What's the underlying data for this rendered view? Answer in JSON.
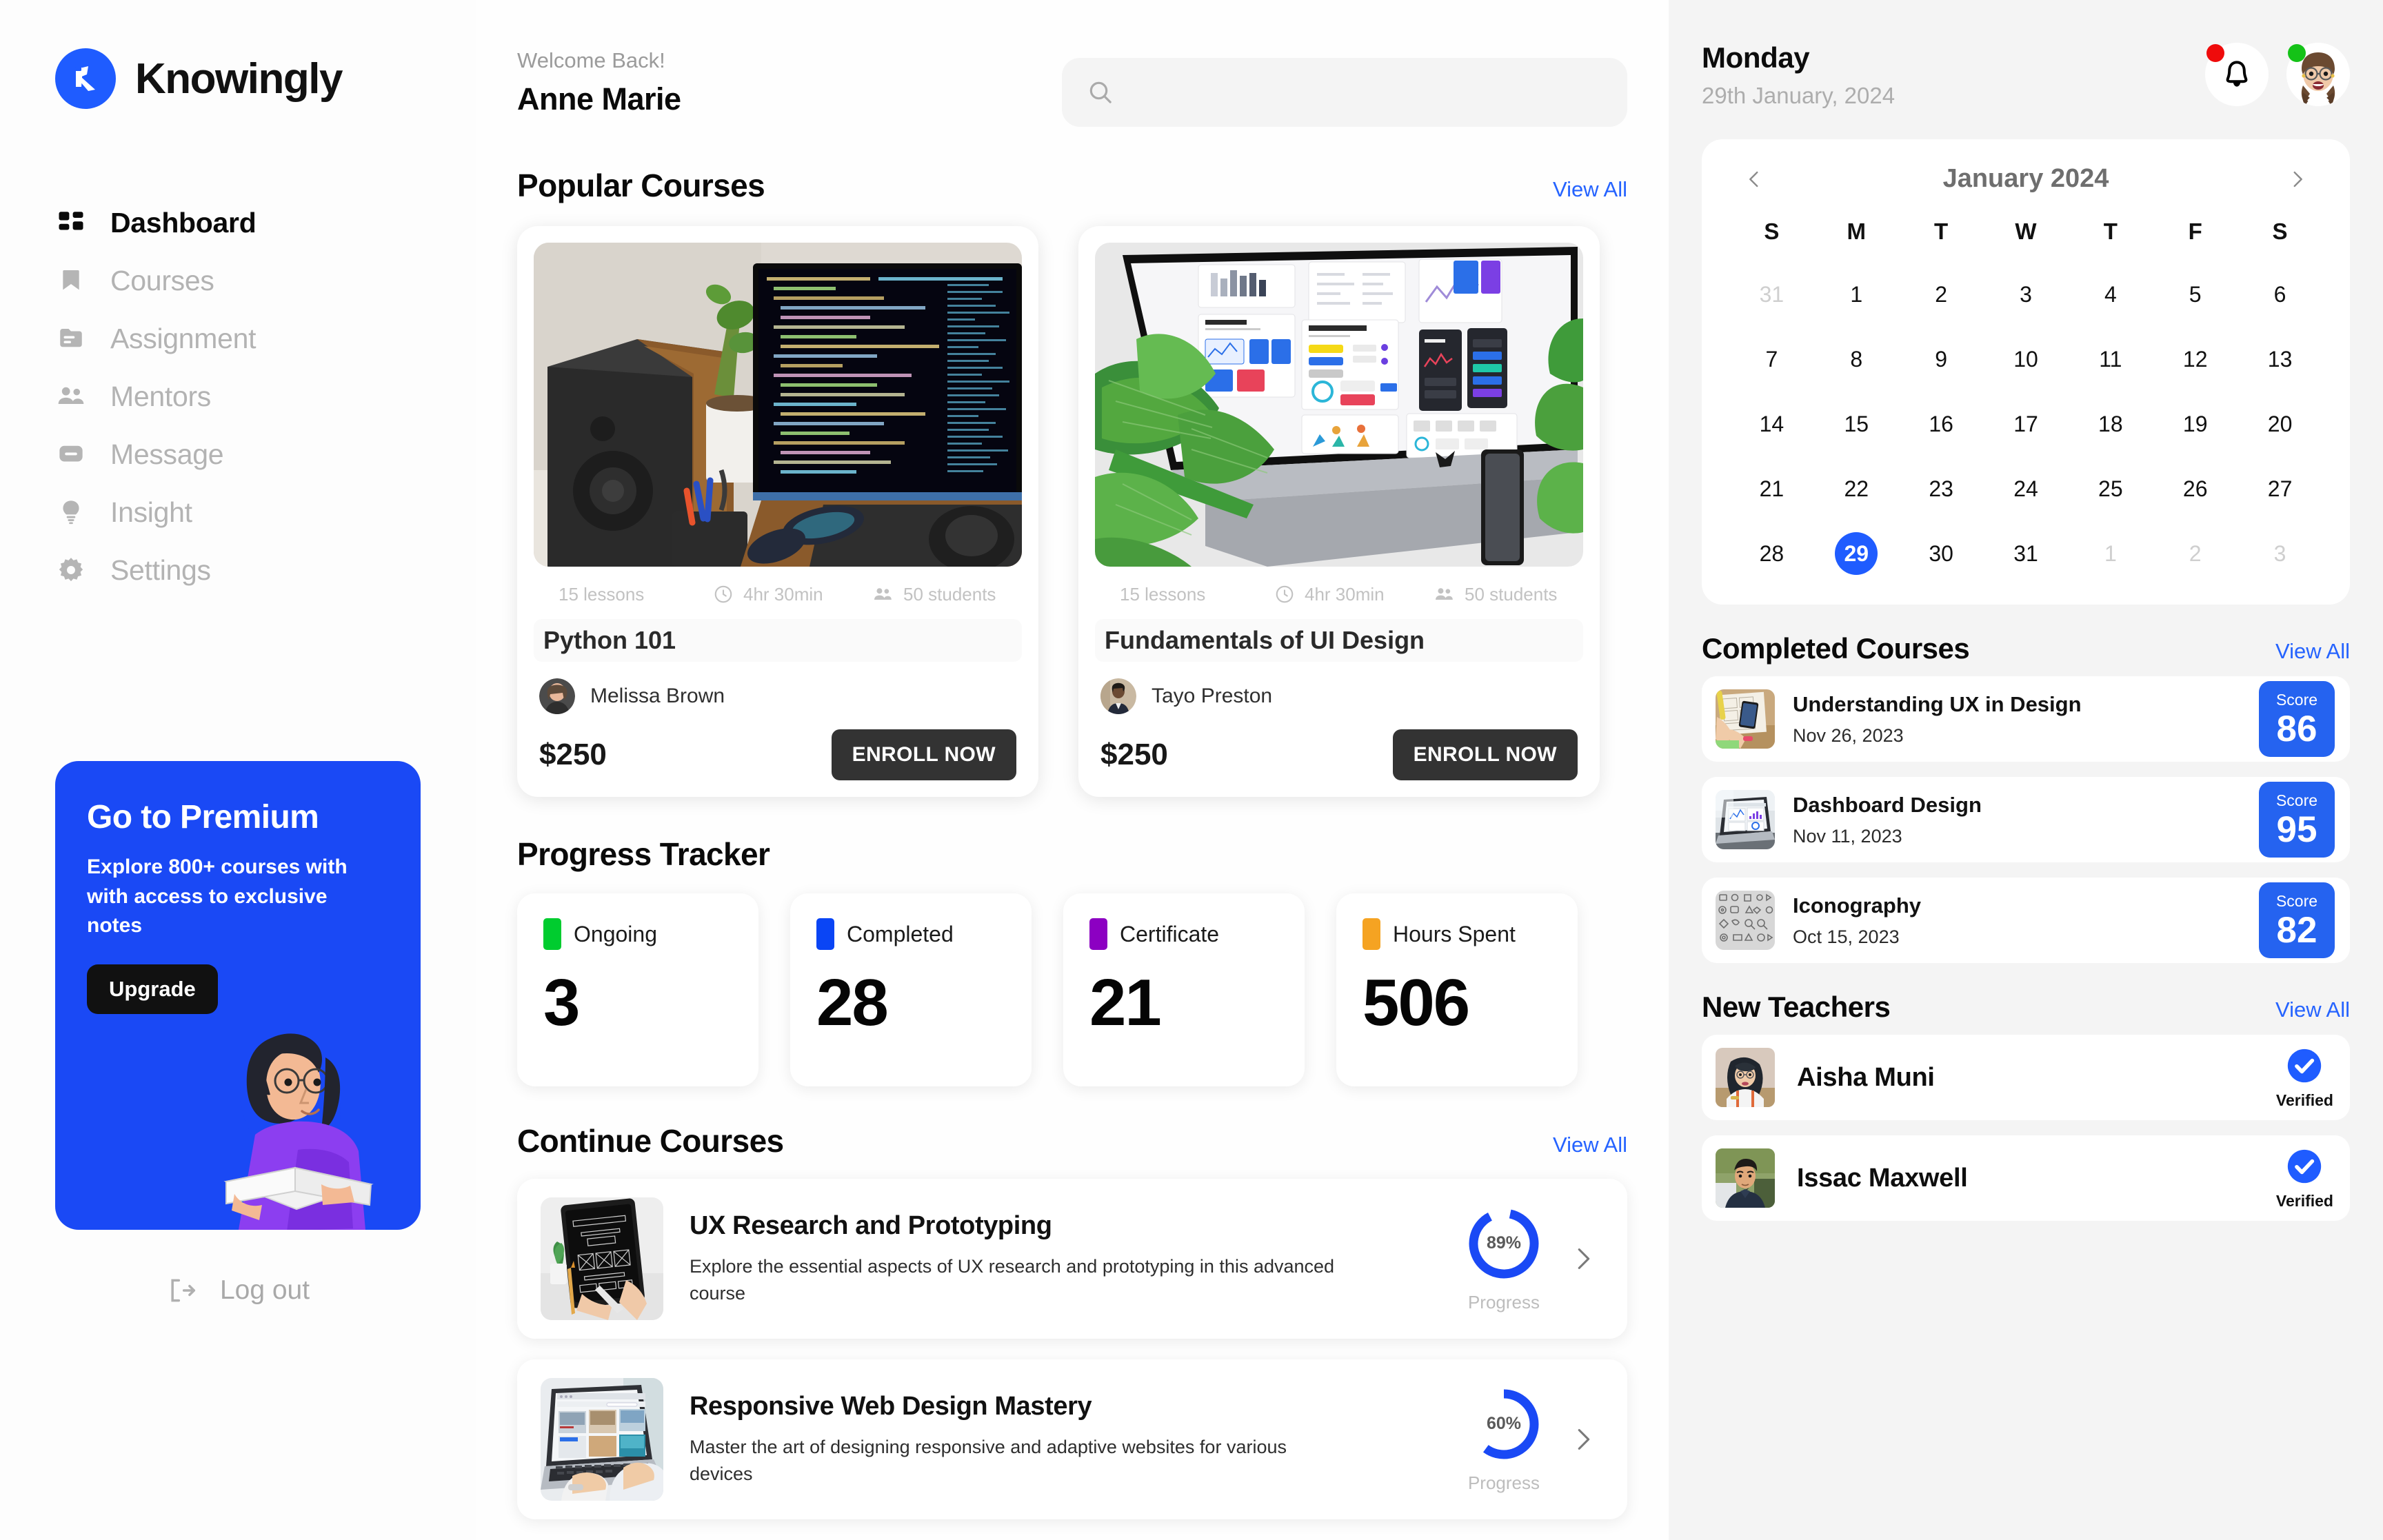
{
  "brand": {
    "name": "Knowingly",
    "logo_icon": "knowingly-k-logo",
    "accent": "#1f5cff"
  },
  "sidebar": {
    "items": [
      {
        "label": "Dashboard",
        "icon": "grid-icon",
        "active": true
      },
      {
        "label": "Courses",
        "icon": "bookmark-icon",
        "active": false
      },
      {
        "label": "Assignment",
        "icon": "folder-icon",
        "active": false
      },
      {
        "label": "Mentors",
        "icon": "people-icon",
        "active": false
      },
      {
        "label": "Message",
        "icon": "message-icon",
        "active": false
      },
      {
        "label": "Insight",
        "icon": "bulb-icon",
        "active": false
      },
      {
        "label": "Settings",
        "icon": "gear-icon",
        "active": false
      }
    ],
    "premium": {
      "title": "Go to Premium",
      "description": "Explore 800+ courses with with access to exclusive notes",
      "button": "Upgrade",
      "background": "#1a49f5"
    },
    "logout": {
      "label": "Log out",
      "icon": "logout-icon"
    }
  },
  "header": {
    "greeting": "Welcome Back!",
    "user_name": "Anne Marie",
    "search": {
      "placeholder": "",
      "value": "",
      "icon": "search-icon"
    }
  },
  "popular": {
    "title": "Popular Courses",
    "view_all": "View All",
    "courses": [
      {
        "name": "Python 101",
        "lessons": "15 lessons",
        "duration": "4hr 30min",
        "students": "50 students",
        "author": "Melissa Brown",
        "price": "$250",
        "cta": "ENROLL NOW",
        "image": "desk-with-code-monitor-and-speaker"
      },
      {
        "name": "Fundamentals of UI Design",
        "lessons": "15 lessons",
        "duration": "4hr 30min",
        "students": "50 students",
        "author": "Tayo Preston",
        "price": "$250",
        "cta": "ENROLL NOW",
        "image": "imac-showing-ui-design-system-with-plant"
      }
    ]
  },
  "progress_tracker": {
    "title": "Progress Tracker",
    "stats": [
      {
        "label": "Ongoing",
        "value": "3",
        "color": "#00cc2f"
      },
      {
        "label": "Completed",
        "value": "28",
        "color": "#0a45f5"
      },
      {
        "label": "Certificate",
        "value": "21",
        "color": "#8c00c2"
      },
      {
        "label": "Hours Spent",
        "value": "506",
        "color": "#f5a322"
      }
    ]
  },
  "continue_courses": {
    "title": "Continue Courses",
    "view_all": "View All",
    "progress_caption": "Progress",
    "items": [
      {
        "title": "UX Research and Prototyping",
        "description": "Explore the essential aspects of UX research and prototyping in this advanced course",
        "progress": 89,
        "progress_label": "89%",
        "image": "hand-holding-tablet-with-wireframe"
      },
      {
        "title": "Responsive Web Design Mastery",
        "description": "Master the art of designing responsive and adaptive websites for various devices",
        "progress": 60,
        "progress_label": "60%",
        "image": "hands-typing-on-laptop-with-website"
      }
    ]
  },
  "right_panel": {
    "day": "Monday",
    "date": "29th January, 2024",
    "notification": {
      "icon": "bell-icon",
      "badge_color": "#ef0b0b"
    },
    "profile": {
      "icon": "avatar",
      "status_color": "#14c217"
    },
    "calendar": {
      "month_label": "January 2024",
      "prev_icon": "chevron-left-icon",
      "next_icon": "chevron-right-icon",
      "weekdays": [
        "S",
        "M",
        "T",
        "W",
        "T",
        "F",
        "S"
      ],
      "selected_day": 29,
      "cells": [
        {
          "n": "31",
          "mute": true
        },
        {
          "n": "1"
        },
        {
          "n": "2"
        },
        {
          "n": "3"
        },
        {
          "n": "4"
        },
        {
          "n": "5"
        },
        {
          "n": "6"
        },
        {
          "n": "7"
        },
        {
          "n": "8"
        },
        {
          "n": "9"
        },
        {
          "n": "10"
        },
        {
          "n": "11"
        },
        {
          "n": "12"
        },
        {
          "n": "13"
        },
        {
          "n": "14"
        },
        {
          "n": "15"
        },
        {
          "n": "16"
        },
        {
          "n": "17"
        },
        {
          "n": "18"
        },
        {
          "n": "19"
        },
        {
          "n": "20"
        },
        {
          "n": "21"
        },
        {
          "n": "22"
        },
        {
          "n": "23"
        },
        {
          "n": "24"
        },
        {
          "n": "25"
        },
        {
          "n": "26"
        },
        {
          "n": "27"
        },
        {
          "n": "28"
        },
        {
          "n": "29",
          "sel": true
        },
        {
          "n": "30"
        },
        {
          "n": "31"
        },
        {
          "n": "1",
          "mute": true
        },
        {
          "n": "2",
          "mute": true
        },
        {
          "n": "3",
          "mute": true
        }
      ]
    },
    "completed_courses": {
      "title": "Completed Courses",
      "view_all": "View All",
      "score_label": "Score",
      "items": [
        {
          "title": "Understanding UX in Design",
          "date": "Nov 26, 2023",
          "score": "86",
          "image": "sketching-ux-wireframes-on-paper"
        },
        {
          "title": "Dashboard Design",
          "date": "Nov 11, 2023",
          "score": "95",
          "image": "laptop-showing-dashboard-charts"
        },
        {
          "title": "Iconography",
          "date": "Oct 15, 2023",
          "score": "82",
          "image": "grid-of-grey-icons"
        }
      ]
    },
    "new_teachers": {
      "title": "New Teachers",
      "view_all": "View All",
      "verified_label": "Verified",
      "items": [
        {
          "name": "Aisha Muni",
          "verified": true,
          "image": "woman-in-hijab-portrait"
        },
        {
          "name": "Issac Maxwell",
          "verified": true,
          "image": "young-man-portrait"
        }
      ]
    }
  }
}
